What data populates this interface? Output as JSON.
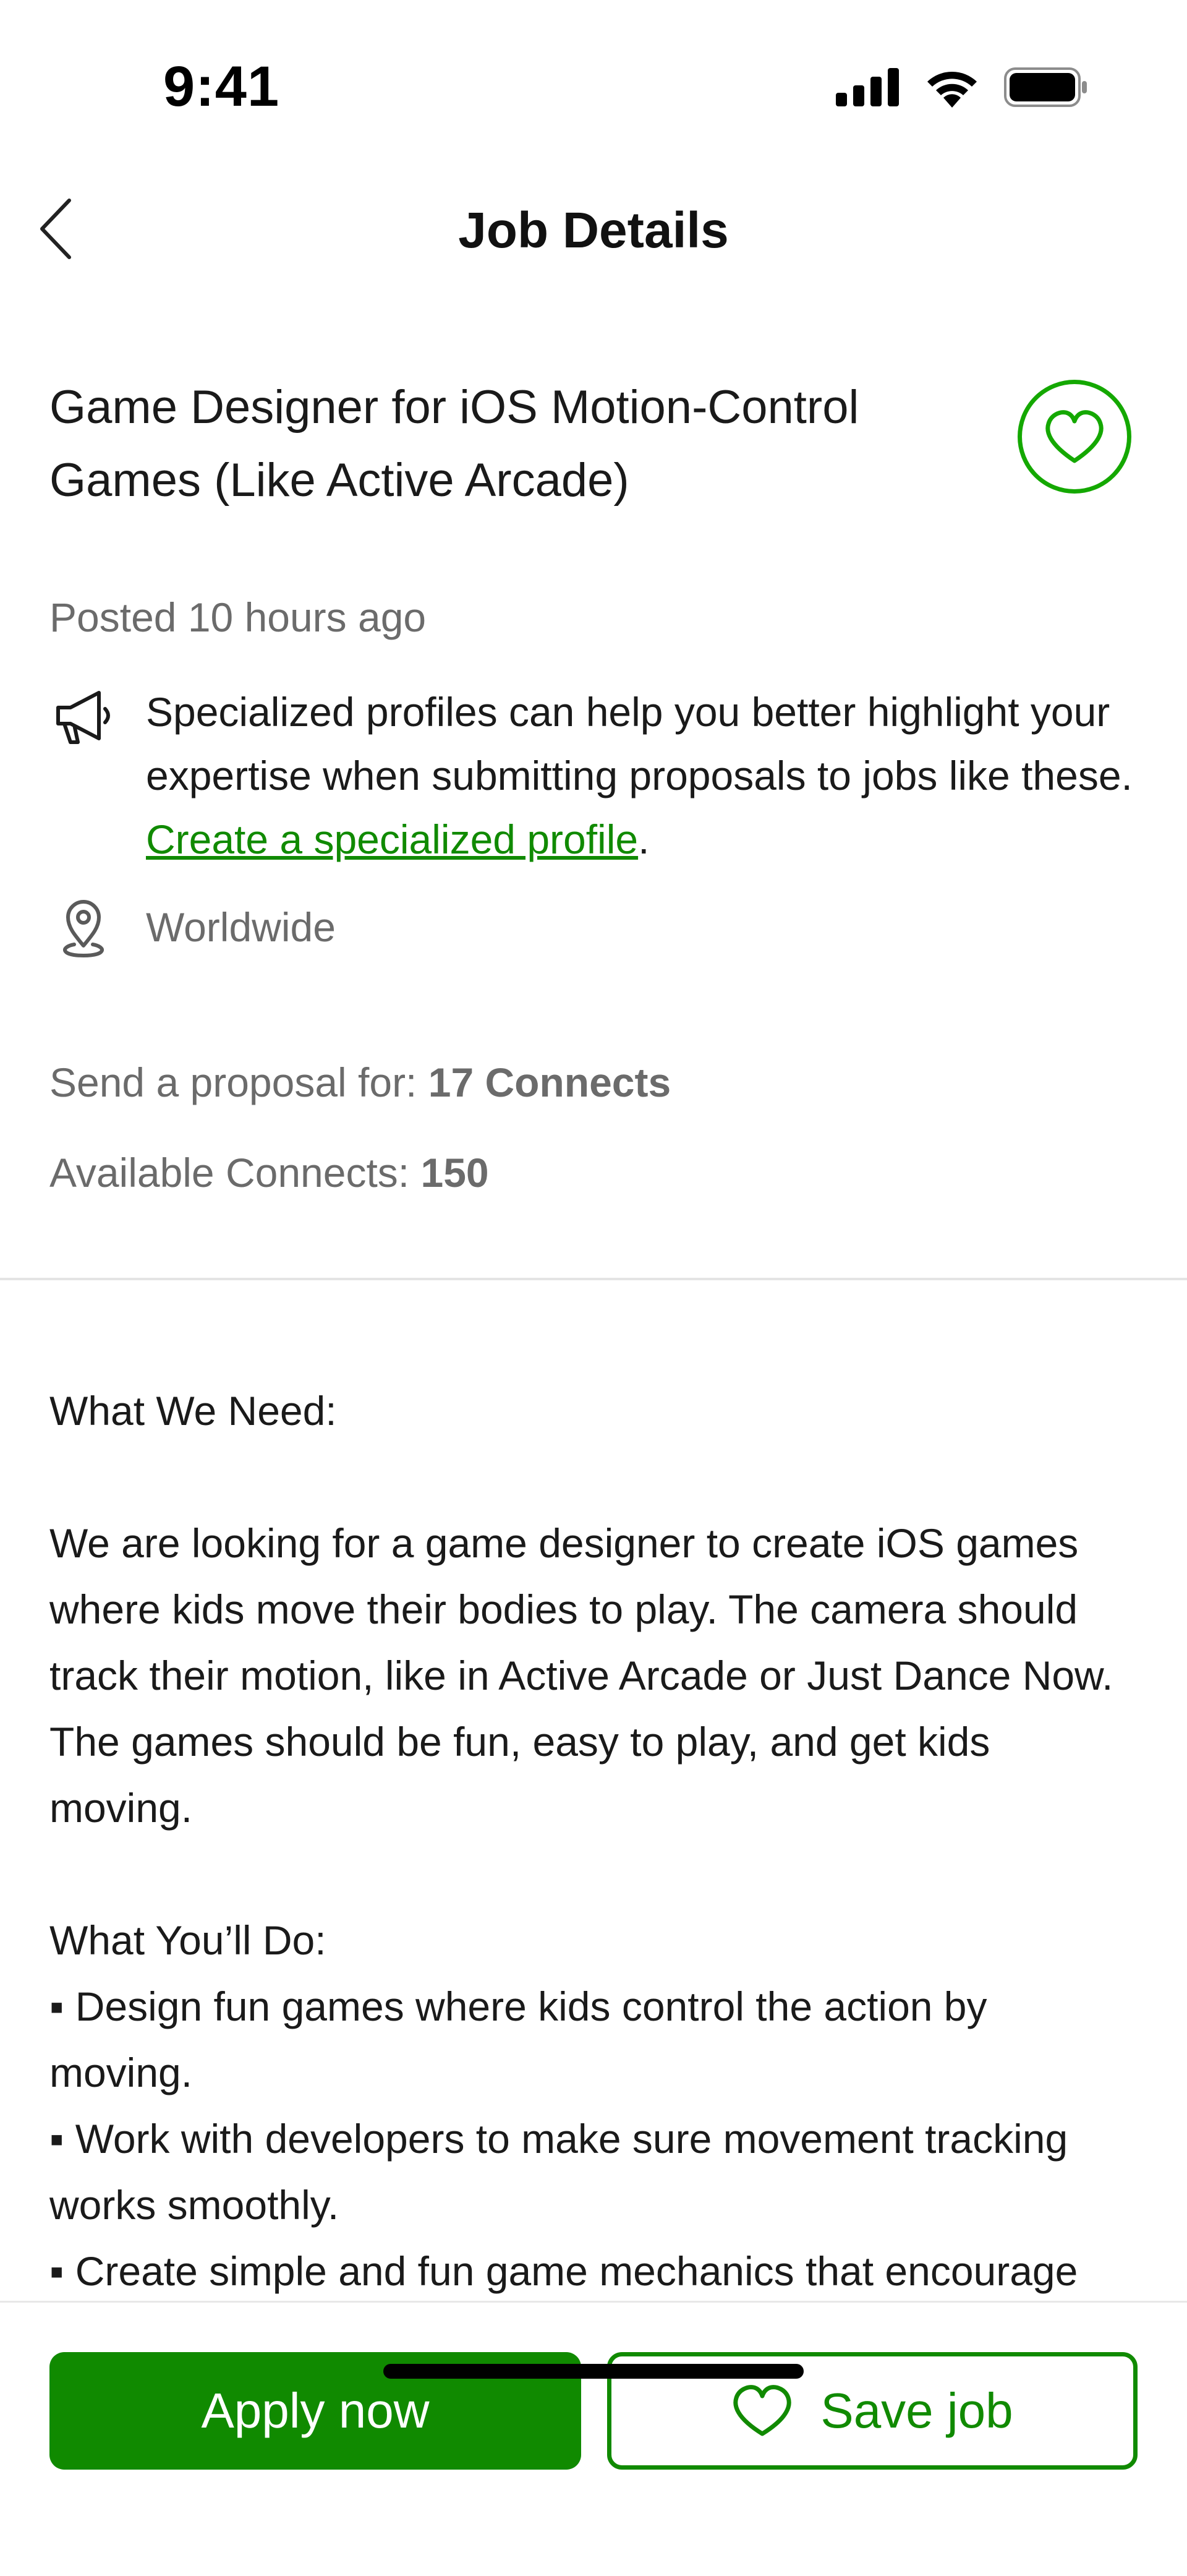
{
  "status_bar": {
    "time": "9:41"
  },
  "nav": {
    "title": "Job Details"
  },
  "job": {
    "title": "Game Designer for iOS Motion-Control Games (Like Active Arcade)",
    "posted": "Posted 10 hours ago",
    "promo_text": "Specialized profiles can help you better highlight your expertise when submitting proposals to jobs like these. ",
    "promo_link": "Create a specialized profile",
    "promo_end": ".",
    "location": "Worldwide",
    "proposal_label": "Send a proposal for: ",
    "proposal_value": "17 Connects",
    "available_label": "Available Connects: ",
    "available_value": "150"
  },
  "description": {
    "heading_need": "What We Need:",
    "need_body": "We are looking for a game designer to create iOS games where kids move their bodies to play. The camera should track their motion, like in Active Arcade or Just Dance Now. The games should be fun, easy to play, and get kids moving.",
    "heading_do": "What You’ll Do:",
    "bullets": [
      "▪ Design fun games where kids control the action by moving.",
      "▪ Work with developers to make sure movement tracking works smoothly.",
      "▪ Create simple and fun game mechanics that encourage"
    ]
  },
  "actions": {
    "apply_label": "Apply now",
    "save_label": "Save job"
  },
  "colors": {
    "accent": "#108a00",
    "accent_light": "#14a800",
    "muted_text": "#6b6b6b"
  },
  "icons": {
    "back": "chevron-left-icon",
    "favorite": "heart-icon",
    "promo": "megaphone-icon",
    "location": "location-pin-icon",
    "signal": "cellular-signal-icon",
    "wifi": "wifi-icon",
    "battery": "battery-icon"
  }
}
